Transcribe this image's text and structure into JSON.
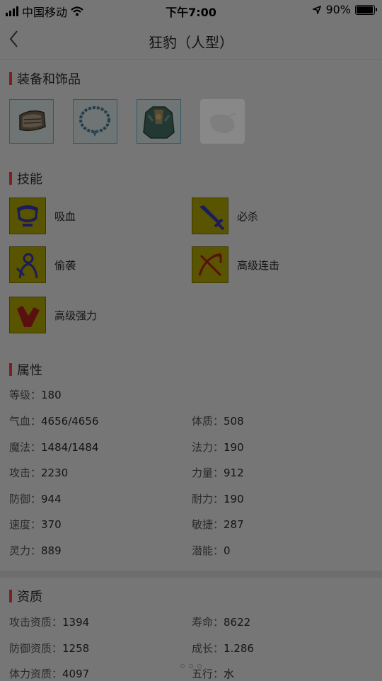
{
  "status_bar": {
    "carrier": "中国移动",
    "time": "下午7:00",
    "battery": "90%"
  },
  "nav": {
    "title": "狂豹（人型）"
  },
  "equipment": {
    "title": "装备和饰品",
    "items": [
      {
        "name": "armguard",
        "empty": false
      },
      {
        "name": "necklace",
        "empty": false
      },
      {
        "name": "armor",
        "empty": false
      },
      {
        "name": "empty-slot",
        "empty": true
      }
    ]
  },
  "skills": {
    "title": "技能",
    "items": [
      {
        "label": "吸血",
        "icon": "vampire-skill-icon"
      },
      {
        "label": "必杀",
        "icon": "sword-skill-icon"
      },
      {
        "label": "偷袭",
        "icon": "sneak-attack-skill-icon"
      },
      {
        "label": "高级连击",
        "icon": "combo-skill-icon"
      },
      {
        "label": "高级强力",
        "icon": "power-skill-icon"
      }
    ]
  },
  "attributes": {
    "title": "属性",
    "rows": [
      {
        "k": "等级：",
        "v": "180"
      },
      {
        "k": "气血：",
        "v": "4656/4656"
      },
      {
        "k": "体质：",
        "v": "508"
      },
      {
        "k": "魔法：",
        "v": "1484/1484"
      },
      {
        "k": "法力：",
        "v": "190"
      },
      {
        "k": "攻击：",
        "v": "2230"
      },
      {
        "k": "力量：",
        "v": "912"
      },
      {
        "k": "防御：",
        "v": "944"
      },
      {
        "k": "耐力：",
        "v": "190"
      },
      {
        "k": "速度：",
        "v": "370"
      },
      {
        "k": "敏捷：",
        "v": "287"
      },
      {
        "k": "灵力：",
        "v": "889"
      },
      {
        "k": "潜能：",
        "v": "0"
      }
    ]
  },
  "qualifications": {
    "title": "资质",
    "rows": [
      {
        "k": "攻击资质：",
        "v": "1394"
      },
      {
        "k": "寿命：",
        "v": "8622"
      },
      {
        "k": "防御资质：",
        "v": "1258"
      },
      {
        "k": "成长：",
        "v": "1.286"
      },
      {
        "k": "体力资质：",
        "v": "4097"
      },
      {
        "k": "五行：",
        "v": "水"
      }
    ]
  },
  "colors": {
    "overlay_bg": "#767676",
    "accent_bar": "#7a2020",
    "skill_icon_bg": "#595400"
  }
}
